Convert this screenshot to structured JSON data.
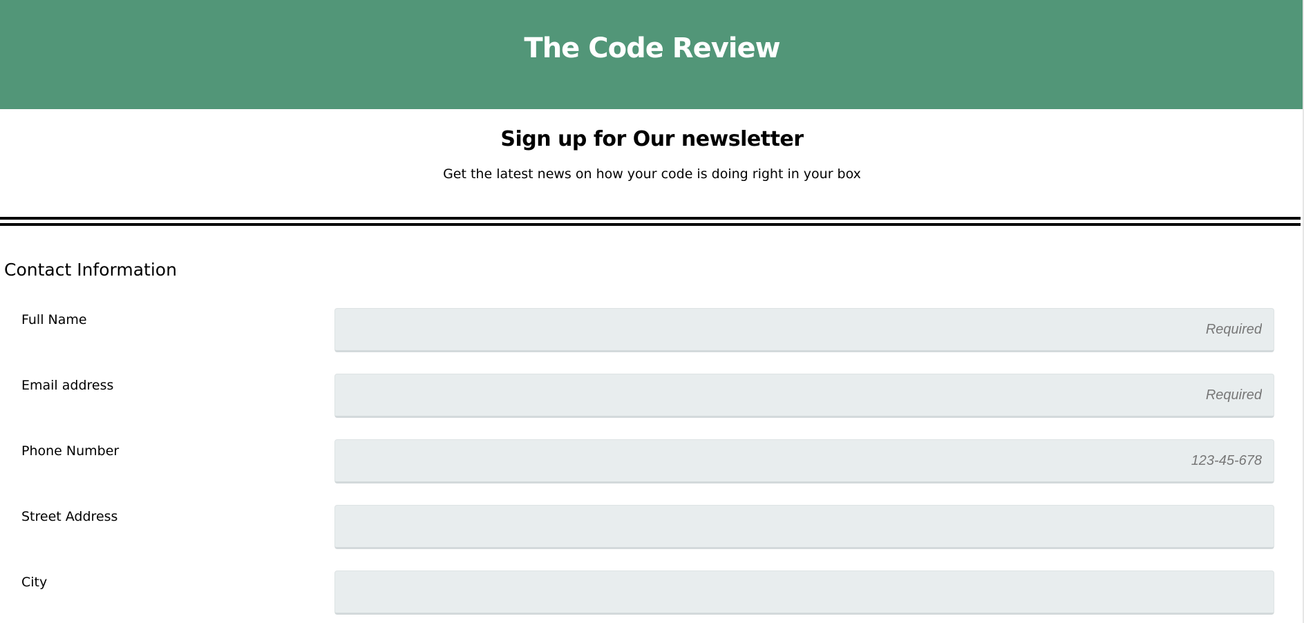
{
  "header": {
    "title": "The Code Review"
  },
  "intro": {
    "heading": "Sign up for Our newsletter",
    "subtitle": "Get the latest news on how your code is doing right in your box"
  },
  "form": {
    "section_title": "Contact Information",
    "fields": [
      {
        "label": "Full Name",
        "value": "",
        "placeholder": "Required"
      },
      {
        "label": "Email address",
        "value": "",
        "placeholder": "Required"
      },
      {
        "label": "Phone Number",
        "value": "",
        "placeholder": "123-45-678"
      },
      {
        "label": "Street Address",
        "value": "",
        "placeholder": ""
      },
      {
        "label": "City",
        "value": "",
        "placeholder": ""
      }
    ]
  },
  "colors": {
    "header_background": "#529678",
    "header_text": "#ffffff",
    "input_background": "#e8edee",
    "divider": "#000000"
  }
}
